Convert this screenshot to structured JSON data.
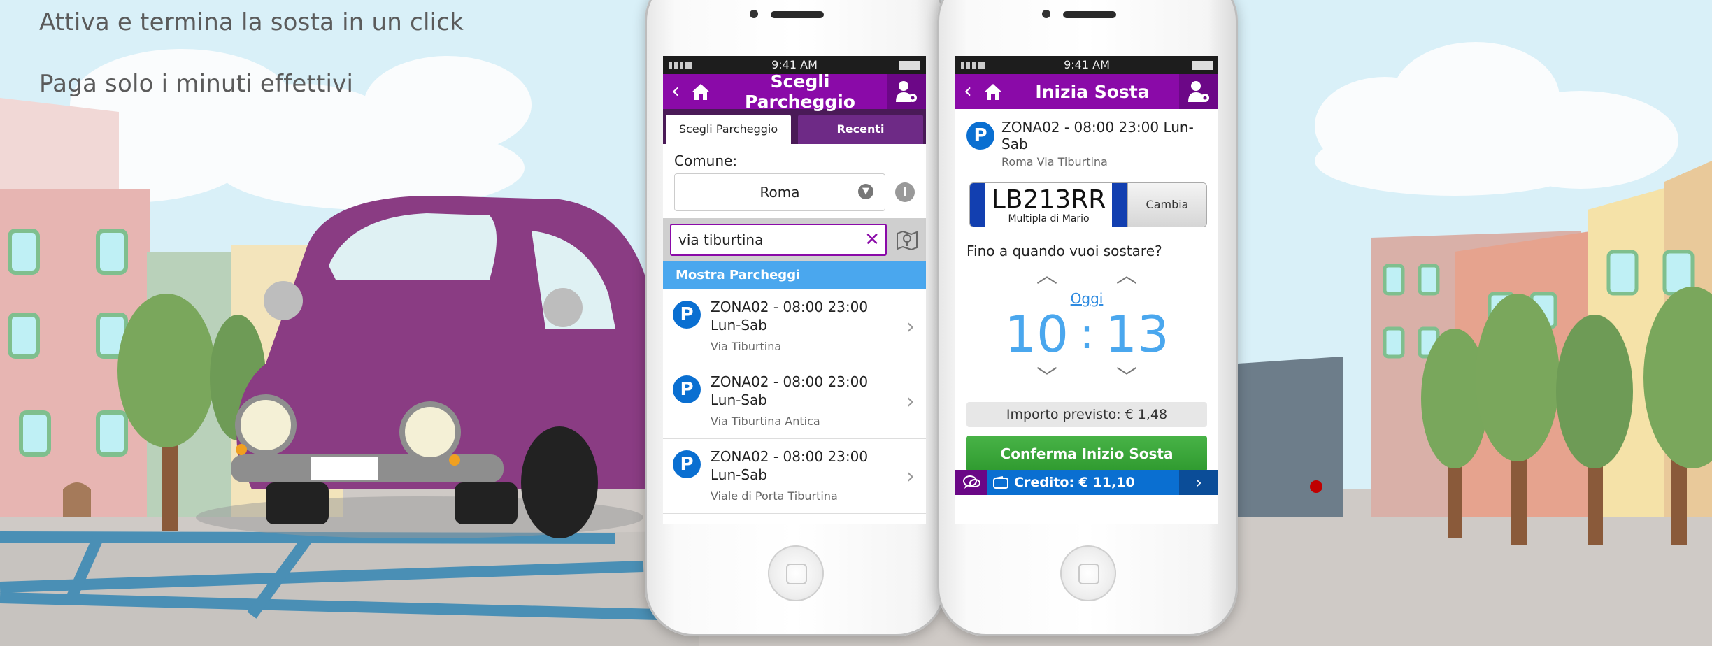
{
  "promo": {
    "line1": "Attiva e termina la sosta in un click",
    "line2": "Paga solo i minuti effettivi"
  },
  "colors": {
    "brand_purple": "#8a0aa8",
    "accent_blue": "#4aa7ee",
    "confirm_green": "#3aa53a",
    "credit_blue": "#0a6fd1"
  },
  "phone1": {
    "status_time": "9:41 AM",
    "nav": {
      "back_icon": "chevron-left-icon",
      "home_icon": "home-icon",
      "title": "Scegli Parcheggio",
      "user_icon": "user-settings-icon"
    },
    "tabs": [
      {
        "label": "Scegli Parcheggio",
        "active": true
      },
      {
        "label": "Recenti",
        "active": false
      }
    ],
    "comune_label": "Comune:",
    "comune_value": "Roma",
    "info_symbol": "i",
    "search": {
      "value": "via tiburtina",
      "placeholder": ""
    },
    "section_header": "Mostra Parcheggi",
    "list": [
      {
        "icon": "P",
        "title": "ZONA02  - 08:00 23:00 Lun-Sab",
        "subtitle": "Via Tiburtina"
      },
      {
        "icon": "P",
        "title": "ZONA02  - 08:00 23:00 Lun-Sab",
        "subtitle": "Via Tiburtina Antica"
      },
      {
        "icon": "P",
        "title": "ZONA02  - 08:00 23:00 Lun-Sab",
        "subtitle": "Viale di Porta Tiburtina"
      }
    ]
  },
  "phone2": {
    "status_time": "9:41 AM",
    "nav": {
      "back_icon": "chevron-left-icon",
      "home_icon": "home-icon",
      "title": "Inizia Sosta",
      "user_icon": "user-settings-icon"
    },
    "zone": {
      "icon": "P",
      "title": "ZONA02  - 08:00 23:00 Lun-Sab",
      "subtitle": "Roma Via Tiburtina"
    },
    "plate": {
      "number": "LB213RR",
      "model": "Multipla di Mario",
      "change_label": "Cambia"
    },
    "question": "Fino a quando vuoi sostare?",
    "day_label": "Oggi",
    "hours": "10",
    "separator": ":",
    "minutes": "13",
    "importo": "Importo previsto:  € 1,48",
    "confirm_label": "Conferma Inizio Sosta",
    "credit": "Credito: € 11,10"
  }
}
